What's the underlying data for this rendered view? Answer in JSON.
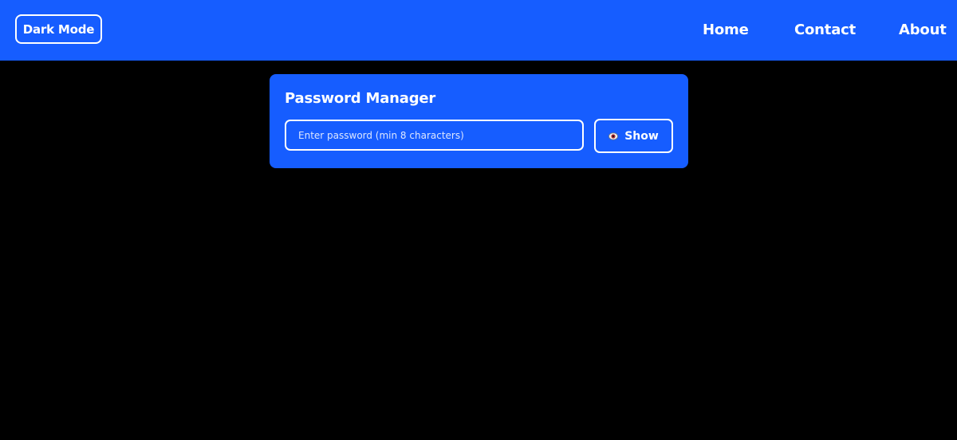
{
  "header": {
    "mode_toggle_label": "Dark Mode",
    "nav": {
      "home": "Home",
      "contact": "Contact",
      "about": "About"
    }
  },
  "card": {
    "title": "Password Manager",
    "password_input": {
      "value": "",
      "placeholder": "Enter password (min 8 characters)"
    },
    "show_button": {
      "icon": "eye-icon",
      "label": "Show"
    }
  },
  "colors": {
    "accent": "#165dff",
    "background": "#000000",
    "text": "#ffffff"
  }
}
